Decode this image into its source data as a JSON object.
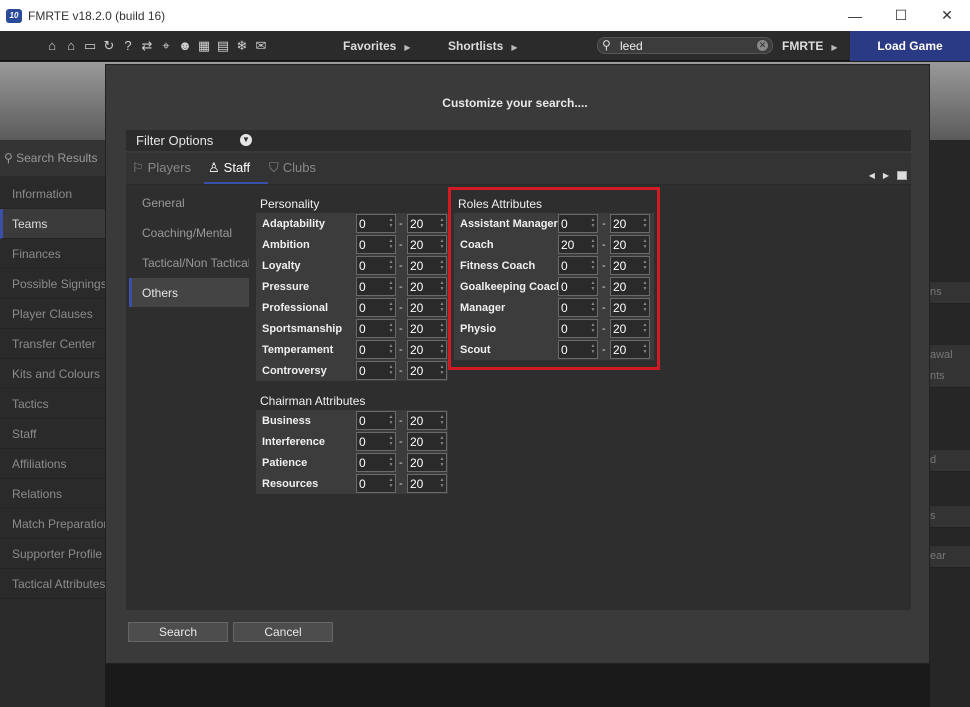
{
  "window": {
    "title": "FMRTE v18.2.0 (build 16)",
    "logo_text": "10",
    "minimize": "—",
    "maximize": "☐",
    "close": "✕"
  },
  "toolbar": {
    "icons": [
      "home-icon",
      "club-icon",
      "monitor-icon",
      "refresh-icon",
      "help-icon",
      "transfer-icon",
      "binoculars-icon",
      "people-icon",
      "calendar-icon",
      "news-icon",
      "snowflake-icon",
      "mail-icon"
    ],
    "icon_glyphs": [
      "⌂",
      "⌂",
      "▭",
      "↻",
      "?",
      "⇄",
      "⌖",
      "☻",
      "▦",
      "▤",
      "❄",
      "✉"
    ],
    "favorites": "Favorites",
    "shortlists": "Shortlists",
    "search_value": "leed",
    "fmrte": "FMRTE",
    "load_game": "Load Game"
  },
  "sidebar": {
    "search_label": "Search Results",
    "items": [
      "Information",
      "Teams",
      "Finances",
      "Possible Signings",
      "Player Clauses",
      "Transfer Center",
      "Kits and Colours",
      "Tactics",
      "Staff",
      "Affiliations",
      "Relations",
      "Match Preparation",
      "Supporter Profile",
      "Tactical Attributes"
    ],
    "active_index": 1
  },
  "right_partial": [
    "ns",
    "awal",
    "nts",
    "d",
    "s",
    "ear"
  ],
  "modal": {
    "title": "Customize your search....",
    "filter_options": "Filter Options",
    "tabs": [
      {
        "label": "Players",
        "icon": "player-icon"
      },
      {
        "label": "Staff",
        "icon": "staff-icon"
      },
      {
        "label": "Clubs",
        "icon": "shield-icon"
      }
    ],
    "active_tab": "Staff",
    "nav": [
      "General",
      "Coaching/Mental",
      "Tactical/Non Tactical",
      "Others"
    ],
    "active_nav": "Others",
    "personality": {
      "title": "Personality",
      "rows": [
        {
          "label": "Adaptability",
          "min": "0",
          "max": "20"
        },
        {
          "label": "Ambition",
          "min": "0",
          "max": "20"
        },
        {
          "label": "Loyalty",
          "min": "0",
          "max": "20"
        },
        {
          "label": "Pressure",
          "min": "0",
          "max": "20"
        },
        {
          "label": "Professional",
          "min": "0",
          "max": "20"
        },
        {
          "label": "Sportsmanship",
          "min": "0",
          "max": "20"
        },
        {
          "label": "Temperament",
          "min": "0",
          "max": "20"
        },
        {
          "label": "Controversy",
          "min": "0",
          "max": "20"
        }
      ]
    },
    "chairman": {
      "title": "Chairman Attributes",
      "rows": [
        {
          "label": "Business",
          "min": "0",
          "max": "20"
        },
        {
          "label": "Interference",
          "min": "0",
          "max": "20"
        },
        {
          "label": "Patience",
          "min": "0",
          "max": "20"
        },
        {
          "label": "Resources",
          "min": "0",
          "max": "20"
        }
      ]
    },
    "roles": {
      "title": "Roles Attributes",
      "rows": [
        {
          "label": "Assistant Manager",
          "min": "0",
          "max": "20"
        },
        {
          "label": "Coach",
          "min": "20",
          "max": "20"
        },
        {
          "label": "Fitness Coach",
          "min": "0",
          "max": "20"
        },
        {
          "label": "Goalkeeping Coach",
          "min": "0",
          "max": "20"
        },
        {
          "label": "Manager",
          "min": "0",
          "max": "20"
        },
        {
          "label": "Physio",
          "min": "0",
          "max": "20"
        },
        {
          "label": "Scout",
          "min": "0",
          "max": "20"
        }
      ]
    },
    "search_button": "Search",
    "cancel_button": "Cancel"
  },
  "colors": {
    "accent": "#3a4fa8",
    "highlight": "#d11a24",
    "load_game_bg": "#2b3a84"
  }
}
